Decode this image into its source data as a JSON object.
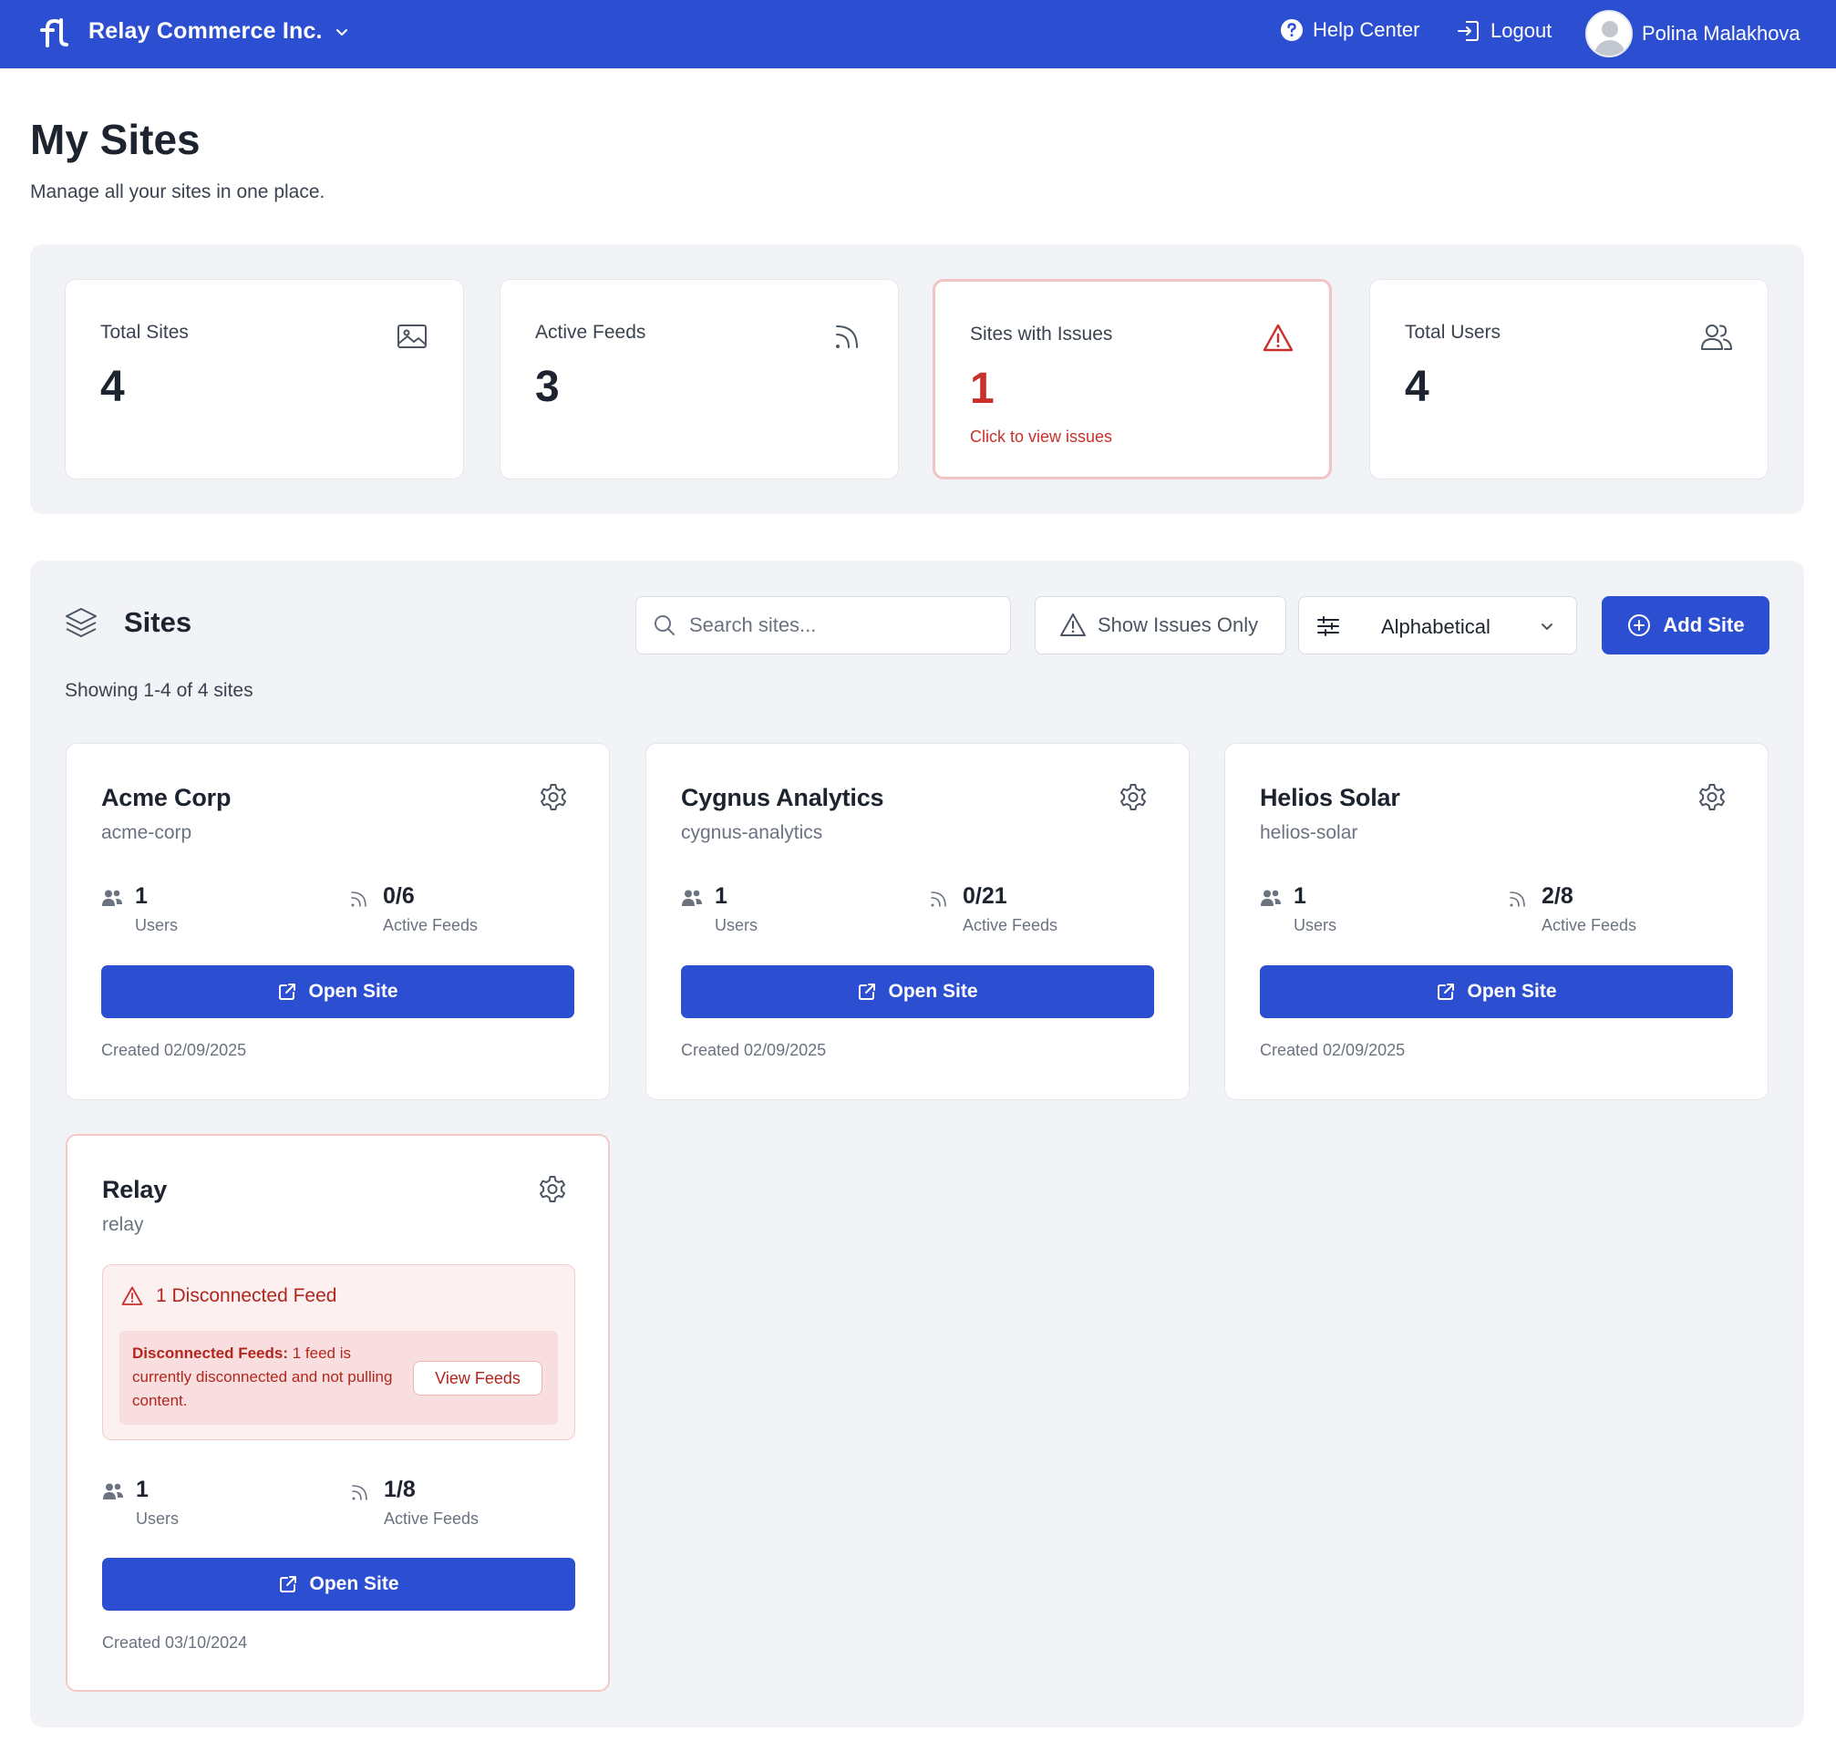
{
  "topbar": {
    "org_name": "Relay Commerce Inc.",
    "help_label": "Help Center",
    "logout_label": "Logout",
    "user_name": "Polina Malakhova"
  },
  "header": {
    "title": "My Sites",
    "subtitle": "Manage all your sites in one place."
  },
  "stats": [
    {
      "label": "Total Sites",
      "value": "4",
      "icon": "image-icon"
    },
    {
      "label": "Active Feeds",
      "value": "3",
      "icon": "rss-icon"
    },
    {
      "label": "Sites with Issues",
      "value": "1",
      "link": "Click to view issues",
      "icon": "alert-triangle-icon"
    },
    {
      "label": "Total Users",
      "value": "4",
      "icon": "users-icon"
    }
  ],
  "sites_section": {
    "title": "Sites",
    "search_placeholder": "Search sites...",
    "issues_button": "Show Issues Only",
    "sort_value": "Alphabetical",
    "add_button": "Add Site",
    "showing_text": "Showing 1-4 of 4 sites"
  },
  "sites": [
    {
      "name": "Acme Corp",
      "slug": "acme-corp",
      "users": "1",
      "users_label": "Users",
      "feeds": "0/6",
      "feeds_label": "Active Feeds",
      "open_label": "Open Site",
      "created": "Created 02/09/2025"
    },
    {
      "name": "Cygnus Analytics",
      "slug": "cygnus-analytics",
      "users": "1",
      "users_label": "Users",
      "feeds": "0/21",
      "feeds_label": "Active Feeds",
      "open_label": "Open Site",
      "created": "Created 02/09/2025"
    },
    {
      "name": "Helios Solar",
      "slug": "helios-solar",
      "users": "1",
      "users_label": "Users",
      "feeds": "2/8",
      "feeds_label": "Active Feeds",
      "open_label": "Open Site",
      "created": "Created 02/09/2025"
    },
    {
      "name": "Relay",
      "slug": "relay",
      "users": "1",
      "users_label": "Users",
      "feeds": "1/8",
      "feeds_label": "Active Feeds",
      "open_label": "Open Site",
      "created": "Created 03/10/2024",
      "alert": {
        "title": "1 Disconnected Feed",
        "bold": "Disconnected Feeds:",
        "text": " 1 feed is currently disconnected and not pulling content.",
        "button": "View Feeds"
      }
    }
  ],
  "colors": {
    "primary": "#2c4fd2",
    "danger": "#c8302c",
    "panel_bg": "#f2f3f6"
  }
}
